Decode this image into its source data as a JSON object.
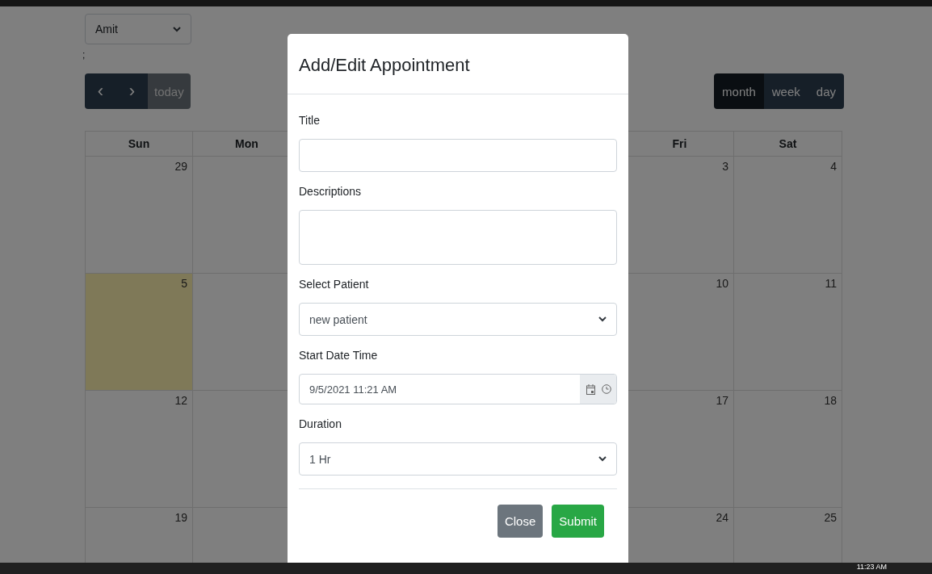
{
  "doctor_select": {
    "value": "Amit"
  },
  "stray_text": ";",
  "nav_buttons": [
    {
      "kind": "prev",
      "label": "‹"
    },
    {
      "kind": "next",
      "label": "›"
    },
    {
      "kind": "today",
      "label": "today"
    }
  ],
  "view_buttons": [
    {
      "label": "month",
      "selected": true
    },
    {
      "label": "week",
      "selected": false
    },
    {
      "label": "day",
      "selected": false
    }
  ],
  "calendar": {
    "columns": [
      {
        "label": "Sun",
        "days": [
          {
            "day": "29",
            "today": false
          },
          {
            "day": "5",
            "today": true
          },
          {
            "day": "12",
            "today": false
          },
          {
            "day": "19",
            "today": false
          }
        ]
      },
      {
        "label": "Mon"
      },
      {
        "label": "Fri",
        "days": [
          {
            "day": "3",
            "today": false
          },
          {
            "day": "10",
            "today": false
          },
          {
            "day": "17",
            "today": false
          },
          {
            "day": "24",
            "today": false
          }
        ]
      },
      {
        "label": "Sat",
        "days": [
          {
            "day": "4",
            "today": false
          },
          {
            "day": "11",
            "today": false
          },
          {
            "day": "18",
            "today": false
          },
          {
            "day": "25",
            "today": false
          }
        ]
      }
    ]
  },
  "modal": {
    "title": "Add/Edit Appointment",
    "fields": [
      {
        "kind": "text",
        "label": "Title"
      },
      {
        "kind": "textarea",
        "label": "Descriptions"
      },
      {
        "kind": "select",
        "label": "Select Patient",
        "value": "new patient"
      },
      {
        "kind": "datetime",
        "label": "Start Date Time",
        "value": "9/5/2021 11:21 AM"
      },
      {
        "kind": "select",
        "label": "Duration",
        "value": "1 Hr"
      }
    ],
    "buttons": [
      {
        "kind": "secondary",
        "label": "Close"
      },
      {
        "kind": "success",
        "label": "Submit"
      }
    ]
  },
  "taskbar": {
    "clock": "11:23 AM"
  }
}
